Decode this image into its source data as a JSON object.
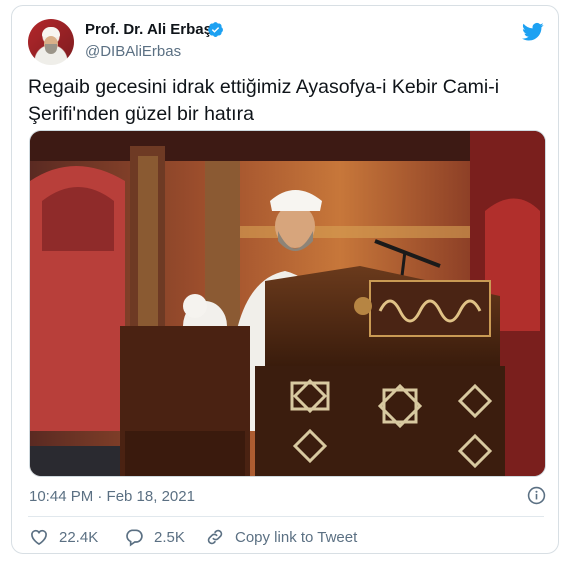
{
  "author": {
    "name": "Prof. Dr. Ali Erbaş",
    "handle": "@DIBAliErbas"
  },
  "tweet": {
    "text_line1": "Regaib gecesini idrak ettiğimiz Ayasofya-i Kebir Cami-i",
    "text_line2": "Şerifi'nden güzel bir hatıra",
    "timestamp": "10:44 PM · Feb 18, 2021"
  },
  "actions": {
    "likes": "22.4K",
    "replies": "2.5K",
    "copy_link": "Copy link to Tweet"
  },
  "icons": [
    "twitter-bird-icon",
    "verified-badge-icon",
    "info-icon",
    "heart-icon",
    "reply-bubble-icon",
    "link-icon"
  ],
  "colors": {
    "brand_blue": "#1da1f2",
    "secondary_text": "#5b7083",
    "border": "#d8dfe4"
  }
}
